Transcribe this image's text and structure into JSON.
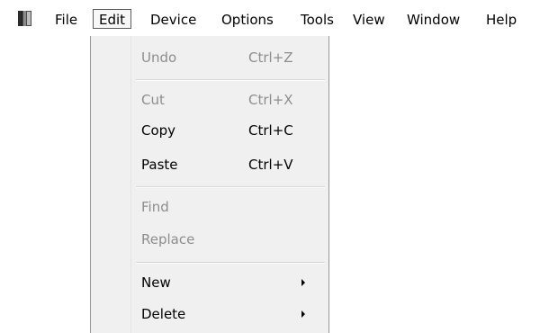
{
  "menubar": {
    "items": [
      {
        "label": "File"
      },
      {
        "label": "Edit"
      },
      {
        "label": "Device"
      },
      {
        "label": "Options"
      },
      {
        "label": "Tools"
      },
      {
        "label": "View"
      },
      {
        "label": "Window"
      },
      {
        "label": "Help"
      }
    ]
  },
  "edit_menu": {
    "undo": {
      "label": "Undo",
      "shortcut": "Ctrl+Z",
      "enabled": false
    },
    "cut": {
      "label": "Cut",
      "shortcut": "Ctrl+X",
      "enabled": false
    },
    "copy": {
      "label": "Copy",
      "shortcut": "Ctrl+C",
      "enabled": true
    },
    "paste": {
      "label": "Paste",
      "shortcut": "Ctrl+V",
      "enabled": true
    },
    "find": {
      "label": "Find",
      "enabled": false
    },
    "replace": {
      "label": "Replace",
      "enabled": false
    },
    "new": {
      "label": "New",
      "has_submenu": true,
      "enabled": true
    },
    "delete": {
      "label": "Delete",
      "has_submenu": true,
      "enabled": true
    }
  },
  "colors": {
    "disabled_text": "#8d8d8d",
    "menu_background": "#f0f0f0",
    "active_border": "#5a5a5a"
  },
  "icons": {
    "app": "book-icon",
    "submenu": "submenu-arrow-icon"
  }
}
